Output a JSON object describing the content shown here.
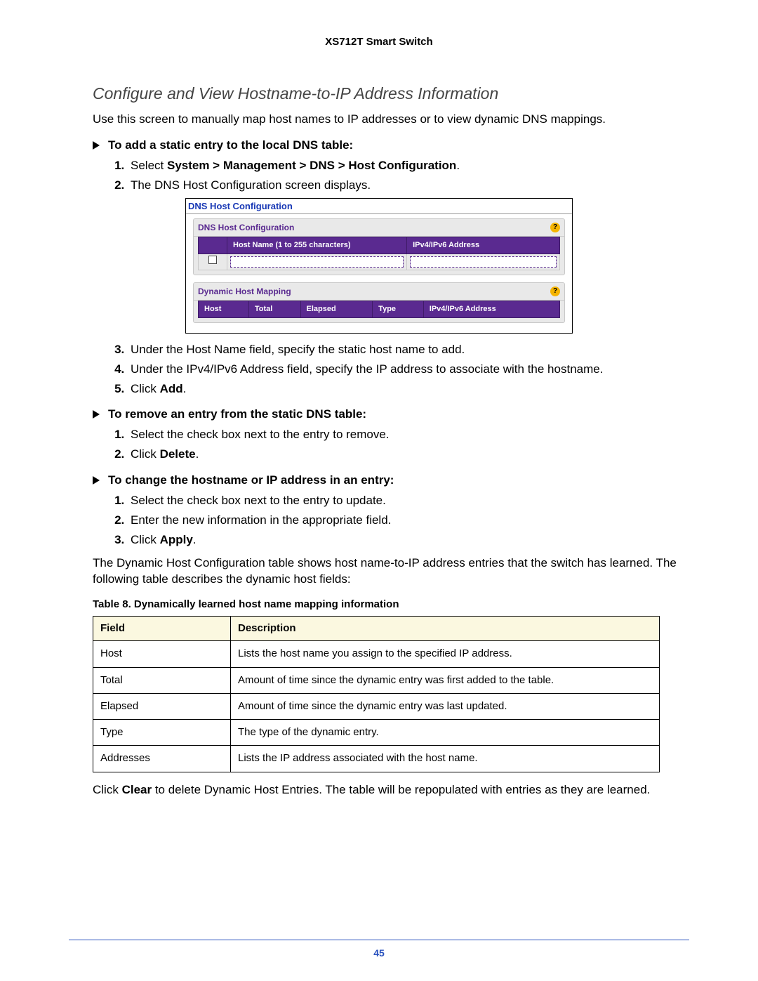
{
  "header": "XS712T Smart Switch",
  "page_number": "45",
  "section_title": "Configure and View Hostname-to-IP Address Information",
  "intro": "Use this screen to manually map host names to IP addresses or to view dynamic DNS mappings.",
  "proc1": {
    "heading": "To add a static entry to the local DNS table:",
    "steps_before": [
      {
        "pre": "Select ",
        "bold": "System > Management > DNS > Host Configuration",
        "post": "."
      },
      {
        "pre": "The DNS Host Configuration screen displays.",
        "bold": "",
        "post": ""
      }
    ],
    "steps_after": [
      {
        "pre": "Under the Host Name field, specify the static host name to add.",
        "bold": "",
        "post": ""
      },
      {
        "pre": "Under the IPv4/IPv6 Address field, specify the IP address to associate with the hostname.",
        "bold": "",
        "post": ""
      },
      {
        "pre": "Click ",
        "bold": "Add",
        "post": "."
      }
    ]
  },
  "proc2": {
    "heading": "To remove an entry from the static DNS table:",
    "steps": [
      {
        "pre": "Select the check box next to the entry to remove.",
        "bold": "",
        "post": ""
      },
      {
        "pre": "Click ",
        "bold": "Delete",
        "post": "."
      }
    ]
  },
  "proc3": {
    "heading": "To change the hostname or IP address in an entry:",
    "steps": [
      {
        "pre": "Select the check box next to the entry to update.",
        "bold": "",
        "post": ""
      },
      {
        "pre": "Enter the new information in the appropriate field.",
        "bold": "",
        "post": ""
      },
      {
        "pre": "Click ",
        "bold": "Apply",
        "post": "."
      }
    ]
  },
  "dynamic_intro": "The Dynamic Host Configuration table shows host name-to-IP address entries that the switch has learned. The following table describes the dynamic host fields:",
  "table_caption": "Table 8.  Dynamically learned host name mapping information",
  "desc_table": {
    "headers": [
      "Field",
      "Description"
    ],
    "rows": [
      [
        "Host",
        "Lists the host name you assign to the specified IP address."
      ],
      [
        "Total",
        "Amount of time since the dynamic entry was first added to the table."
      ],
      [
        "Elapsed",
        "Amount of time since the dynamic entry was last updated."
      ],
      [
        "Type",
        "The type of the dynamic entry."
      ],
      [
        "Addresses",
        "Lists the IP address associated with the host name."
      ]
    ]
  },
  "clear_note": {
    "pre": "Click ",
    "bold": "Clear",
    "post": " to delete Dynamic Host Entries. The table will be repopulated with entries as they are learned."
  },
  "shot": {
    "outer_title": "DNS Host Configuration",
    "panel1": {
      "title": "DNS Host Configuration",
      "cols": [
        "Host Name (1 to 255 characters)",
        "IPv4/IPv6 Address"
      ]
    },
    "panel2": {
      "title": "Dynamic Host Mapping",
      "cols": [
        "Host",
        "Total",
        "Elapsed",
        "Type",
        "IPv4/IPv6 Address"
      ]
    },
    "help": "?"
  }
}
